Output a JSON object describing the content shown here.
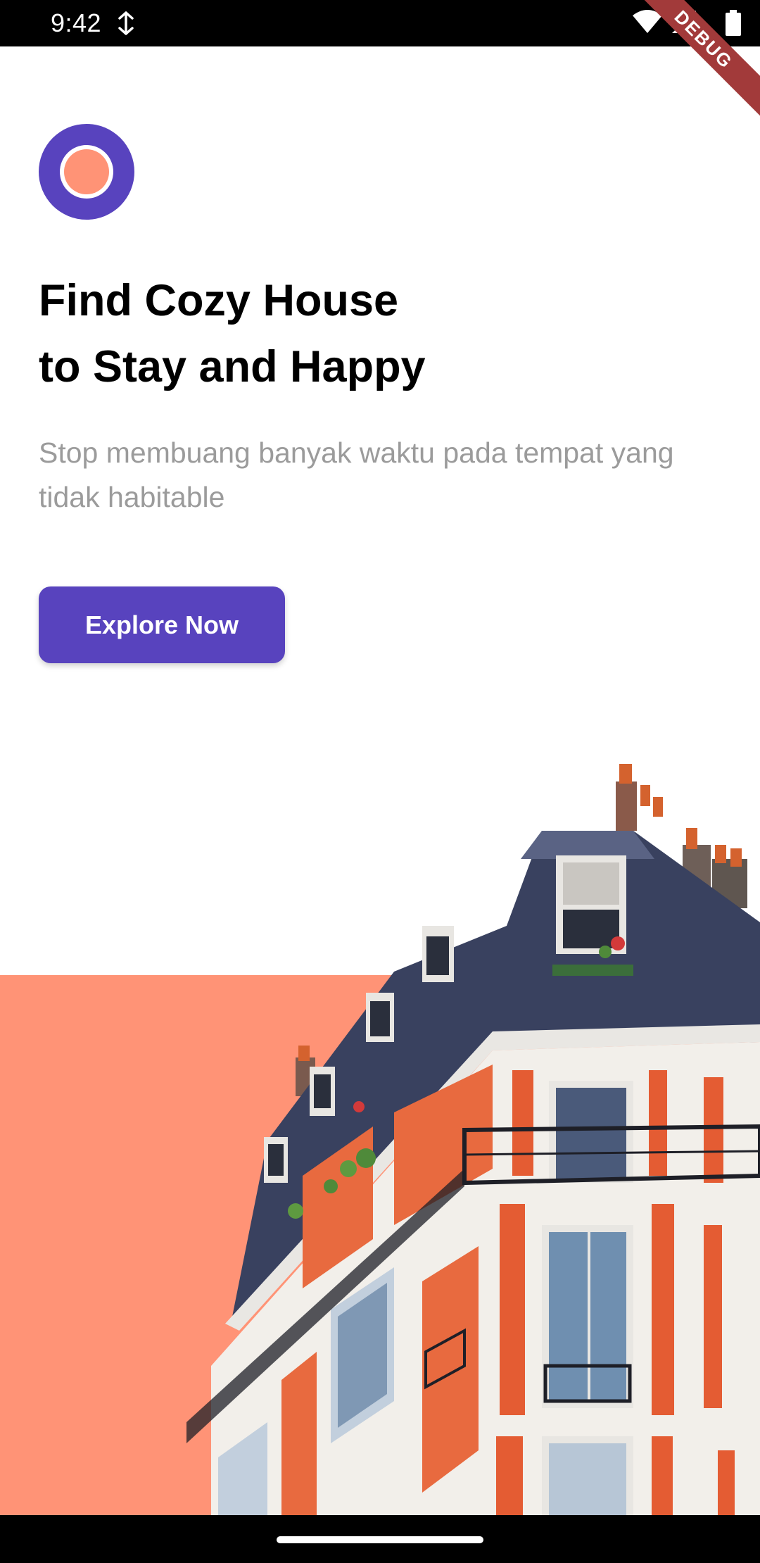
{
  "status_bar": {
    "time": "9:42",
    "icons": [
      "sync-icon",
      "wifi-icon",
      "signal-icon",
      "battery-icon"
    ],
    "debug_label": "DEBUG"
  },
  "hero": {
    "title_line_1": "Find Cozy House",
    "title_line_2": "to Stay and Happy",
    "subtitle": "Stop membuang banyak waktu pada tempat yang tidak habitable",
    "cta_label": "Explore Now"
  },
  "colors": {
    "primary": "#5843BE",
    "accent": "#FF9376",
    "text": "#000000",
    "muted": "#9B9B9B"
  }
}
